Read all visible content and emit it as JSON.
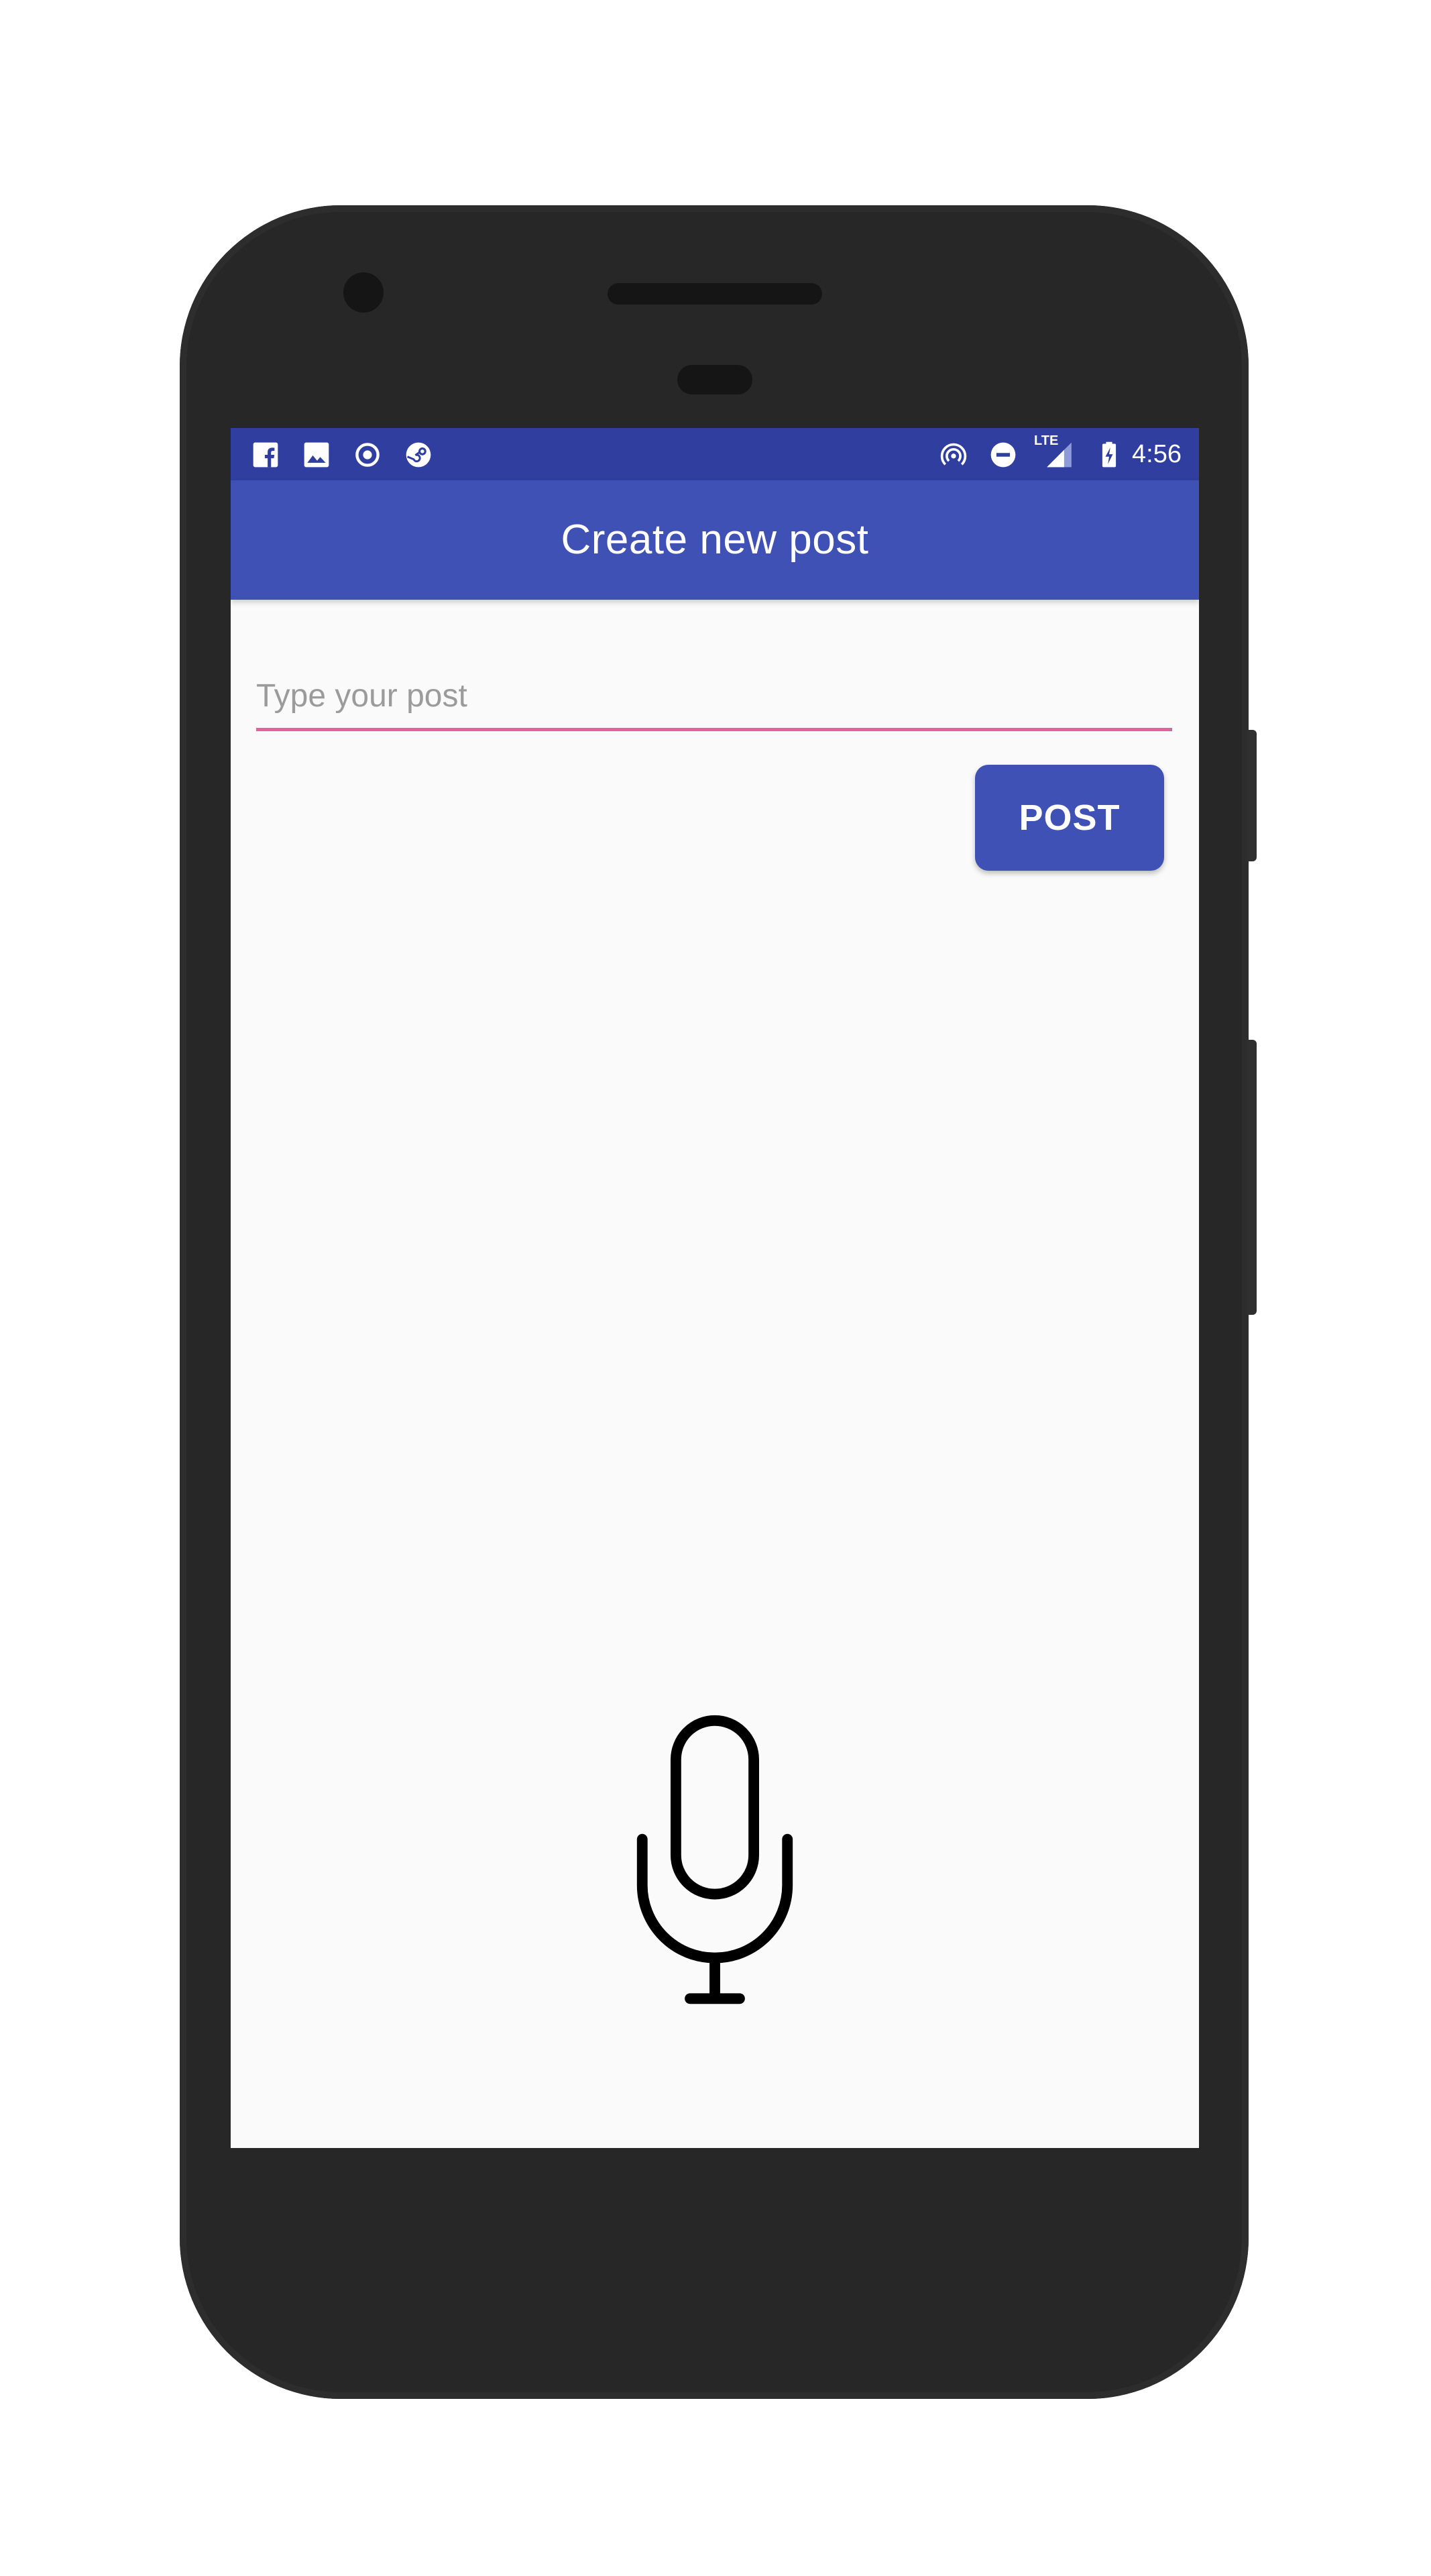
{
  "status_bar": {
    "time": "4:56",
    "left_icons": [
      "facebook-icon",
      "image-icon",
      "record-icon",
      "steam-icon"
    ],
    "right_icons": [
      "hotspot-icon",
      "do-not-disturb-icon",
      "lte-signal-icon",
      "battery-charging-icon"
    ],
    "network_label": "LTE"
  },
  "app_bar": {
    "title": "Create new post"
  },
  "post_form": {
    "input_value": "",
    "input_placeholder": "Type your post",
    "submit_label": "POST"
  },
  "voice": {
    "icon": "microphone-icon"
  },
  "colors": {
    "status_bar": "#303f9f",
    "app_bar": "#3f51b5",
    "button": "#3f51b5",
    "input_underline": "#e2629b",
    "screen_background": "#fafafa",
    "device_body": "#272727"
  }
}
